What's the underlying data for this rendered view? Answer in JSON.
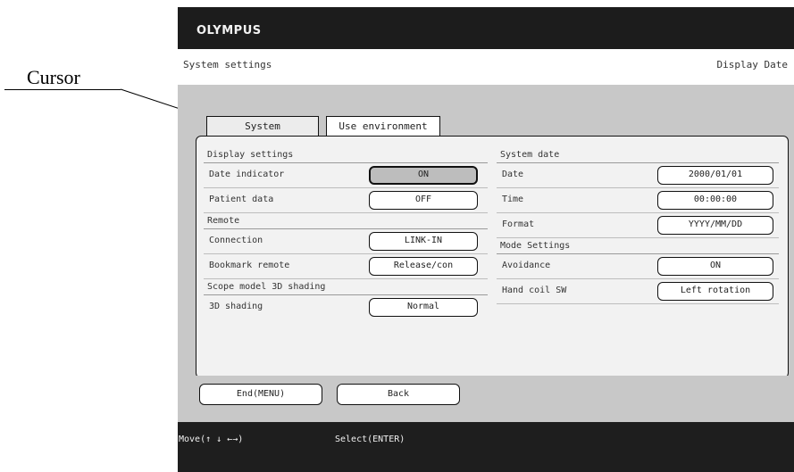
{
  "callout": {
    "label": "Cursor"
  },
  "header": {
    "brand": "OLYMPUS",
    "title": "System settings",
    "mode": "Display Date"
  },
  "tabs": [
    {
      "label": "System"
    },
    {
      "label": "Use environment"
    }
  ],
  "left": {
    "display_settings": {
      "title": "Display settings",
      "rows": [
        {
          "label": "Date indicator",
          "value": "ON"
        },
        {
          "label": "Patient data",
          "value": "OFF"
        }
      ]
    },
    "remote": {
      "title": "Remote",
      "rows": [
        {
          "label": "Connection",
          "value": "LINK-IN"
        },
        {
          "label": "Bookmark remote",
          "value": "Release/con"
        }
      ]
    },
    "scope_model": {
      "title": "Scope model 3D shading",
      "rows": [
        {
          "label": "3D shading",
          "value": "Normal"
        }
      ]
    }
  },
  "right": {
    "system_date": {
      "title": "System date",
      "rows": [
        {
          "label": "Date",
          "value": "2000/01/01"
        },
        {
          "label": "Time",
          "value": "00:00:00"
        },
        {
          "label": "Format",
          "value": "YYYY/MM/DD"
        }
      ]
    },
    "mode_settings": {
      "title": "Mode Settings",
      "rows": [
        {
          "label": "Avoidance",
          "value": "ON"
        },
        {
          "label": "Hand coil SW",
          "value": "Left rotation"
        }
      ]
    }
  },
  "footer_buttons": {
    "end": "End(MENU)",
    "back": "Back"
  },
  "hints": {
    "move": "Move(↑ ↓ ←→)",
    "select": "Select(ENTER)"
  }
}
